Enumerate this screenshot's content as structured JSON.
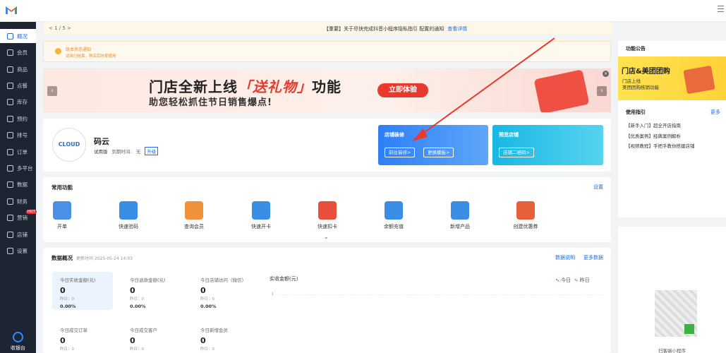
{
  "sidebar": {
    "items": [
      {
        "label": "概况",
        "icon": "grid-icon",
        "active": true
      },
      {
        "label": "会员",
        "icon": "member-icon"
      },
      {
        "label": "商品",
        "icon": "goods-icon"
      },
      {
        "label": "点餐",
        "icon": "order-food-icon"
      },
      {
        "label": "库存",
        "icon": "inventory-icon"
      },
      {
        "label": "预约",
        "icon": "calendar-icon"
      },
      {
        "label": "排号",
        "icon": "queue-icon"
      },
      {
        "label": "订单",
        "icon": "order-icon"
      },
      {
        "label": "多平台",
        "icon": "platform-icon"
      },
      {
        "label": "数据",
        "icon": "data-icon"
      },
      {
        "label": "财务",
        "icon": "finance-icon"
      },
      {
        "label": "营销",
        "icon": "marketing-icon",
        "badge": "HOT"
      },
      {
        "label": "店铺",
        "icon": "store-icon"
      },
      {
        "label": "设置",
        "icon": "settings-icon"
      }
    ],
    "bottom_label": "收银台"
  },
  "notice": {
    "pager": "< 1 / 5 >",
    "text": "【重要】关于尽快完成抖音小程序隐私指引 配置的通知",
    "link": "查看详情"
  },
  "warning": {
    "title": "版本状态通知",
    "text": "试用已结束，购买后恢复使用"
  },
  "banner": {
    "headline_pre": "门店全新上线",
    "headline_em": "「送礼物」",
    "headline_post": "功能",
    "sub": "助您轻松抓住节日销售爆点!",
    "cta": "立即体验"
  },
  "profile": {
    "logo_text": "CLOUD",
    "name": "码云",
    "version": "试用版",
    "expire_label": "到期时间:",
    "expire_value": "无",
    "upgrade": "升级"
  },
  "cards": [
    {
      "title": "店铺装修",
      "buttons": [
        "前往装修>",
        "更换模板>"
      ]
    },
    {
      "title": "预览店铺",
      "buttons": [
        "店铺二维码>"
      ]
    }
  ],
  "common": {
    "title": "常用功能",
    "settings": "设置",
    "items": [
      {
        "label": "开单",
        "color": "#4a90e8"
      },
      {
        "label": "快速验码",
        "color": "#3a8ee6"
      },
      {
        "label": "查询会员",
        "color": "#f0923a"
      },
      {
        "label": "快速开卡",
        "color": "#3a8ee6"
      },
      {
        "label": "快速扣卡",
        "color": "#e8503a"
      },
      {
        "label": "余额充值",
        "color": "#3a8ee6"
      },
      {
        "label": "新增产品",
        "color": "#3a8ee6"
      },
      {
        "label": "创建优惠券",
        "color": "#e8603a"
      }
    ]
  },
  "stats": {
    "title": "数据概况",
    "updated": "更新时间 2025-05-24 14:03",
    "link1": "数据说明",
    "link2": "更多数据",
    "items": [
      {
        "label": "今日实收金额(元)",
        "value": "0",
        "yesterday": "昨日：0",
        "pct": "0.00%"
      },
      {
        "label": "今日退款金额(元)",
        "value": "0",
        "yesterday": "昨日：0",
        "pct": "0.00%"
      },
      {
        "label": "今日店铺访问（微信）",
        "value": "0",
        "yesterday": "昨日：0",
        "pct": "0.00%"
      },
      {
        "label": "今日成交订单",
        "value": "0",
        "yesterday": "昨日：0"
      },
      {
        "label": "今日成交客户",
        "value": "0",
        "yesterday": "昨日：0"
      },
      {
        "label": "今日新增会员",
        "value": "0",
        "yesterday": "昨日：0"
      }
    ],
    "chart_title": "实收金额(元)",
    "legend_today": "今日",
    "legend_yesterday": "昨日",
    "axis_tick": "1"
  },
  "right": {
    "announce_title": "功能公告",
    "promo_title": "门店&美团团购",
    "promo_line1": "门店上线",
    "promo_line2": "美团团购核销功能",
    "guide_title": "使用指引",
    "guide_more": "更多",
    "guides": [
      "【新手入门】超全开店指南",
      "【优质案例】经典案例解析",
      "【视频教程】手把手教你搭建店铺"
    ],
    "qr_label": "扫客端小程序"
  }
}
